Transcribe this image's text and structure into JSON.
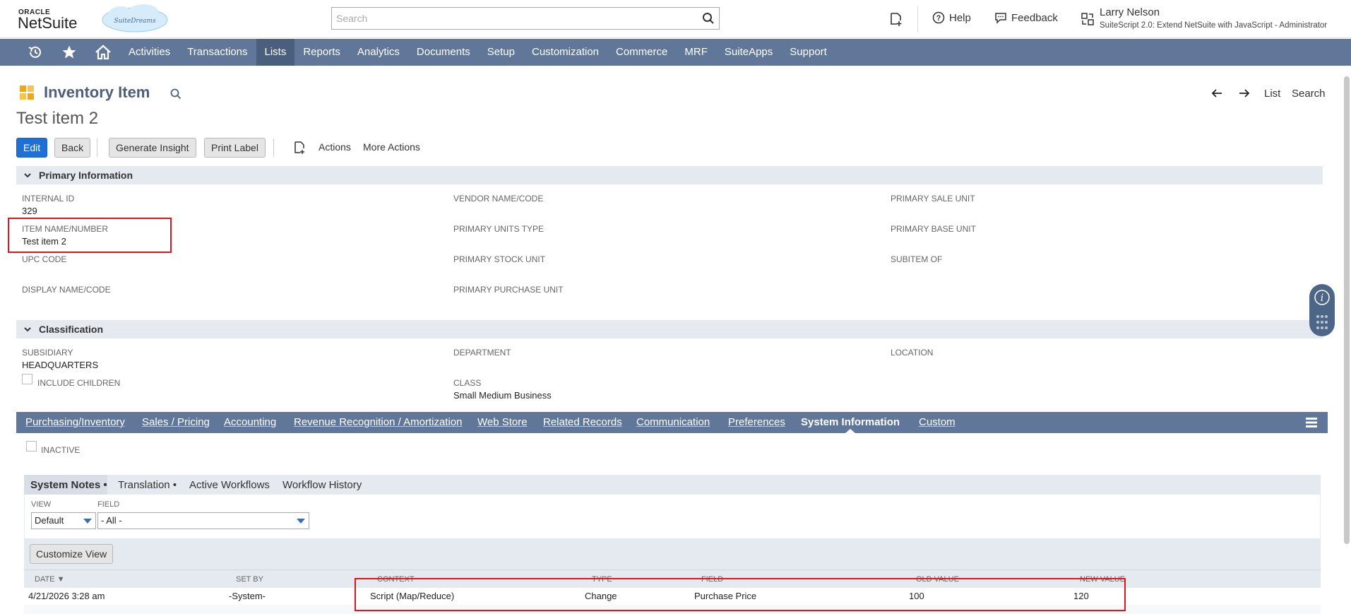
{
  "header": {
    "oracle_label": "ORACLE",
    "netsuite_label": "NetSuite",
    "cloud_label": "SuiteDreams",
    "search_placeholder": "Search",
    "help_label": "Help",
    "feedback_label": "Feedback",
    "user_name": "Larry Nelson",
    "user_role": "SuiteScript 2.0: Extend NetSuite with JavaScript - Administrator"
  },
  "nav": {
    "items": [
      "Activities",
      "Transactions",
      "Lists",
      "Reports",
      "Analytics",
      "Documents",
      "Setup",
      "Customization",
      "Commerce",
      "MRF",
      "SuiteApps",
      "Support"
    ],
    "active": "Lists"
  },
  "record": {
    "type": "Inventory Item",
    "title": "Test item 2",
    "pager": {
      "list": "List",
      "search": "Search"
    }
  },
  "actions": {
    "edit": "Edit",
    "back": "Back",
    "generate_insight": "Generate Insight",
    "print_label": "Print Label",
    "actions": "Actions",
    "more_actions": "More Actions"
  },
  "primary": {
    "section_title": "Primary Information",
    "internal_id_label": "INTERNAL ID",
    "internal_id_value": "329",
    "item_name_label": "ITEM NAME/NUMBER",
    "item_name_value": "Test item 2",
    "upc_label": "UPC CODE",
    "display_name_label": "DISPLAY NAME/CODE",
    "vendor_label": "VENDOR NAME/CODE",
    "units_type_label": "PRIMARY UNITS TYPE",
    "stock_unit_label": "PRIMARY STOCK UNIT",
    "purchase_unit_label": "PRIMARY PURCHASE UNIT",
    "sale_unit_label": "PRIMARY SALE UNIT",
    "base_unit_label": "PRIMARY BASE UNIT",
    "subitem_label": "SUBITEM OF"
  },
  "classification": {
    "section_title": "Classification",
    "subsidiary_label": "SUBSIDIARY",
    "subsidiary_value": "HEADQUARTERS",
    "include_children_label": "INCLUDE CHILDREN",
    "department_label": "DEPARTMENT",
    "class_label": "CLASS",
    "class_value": "Small Medium Business",
    "location_label": "LOCATION"
  },
  "subtabs": {
    "items": [
      "Purchasing/Inventory",
      "Sales / Pricing",
      "Accounting",
      "Revenue Recognition / Amortization",
      "Web Store",
      "Related Records",
      "Communication",
      "Preferences",
      "System Information",
      "Custom"
    ],
    "active": "System Information"
  },
  "system_info": {
    "inactive_label": "INACTIVE",
    "inner_tabs": [
      "System Notes •",
      "Translation •",
      "Active Workflows",
      "Workflow History"
    ],
    "active_inner_tab": "System Notes •",
    "view_label": "VIEW",
    "view_value": "Default",
    "field_label": "FIELD",
    "field_value": "- All -",
    "customize_view": "Customize View",
    "columns": [
      "DATE ▼",
      "SET BY",
      "CONTEXT",
      "TYPE",
      "FIELD",
      "OLD VALUE",
      "NEW VALUE"
    ],
    "rows": [
      {
        "date": "4/21/2026 3:28 am",
        "set_by": "-System-",
        "context": "Script (Map/Reduce)",
        "type": "Change",
        "field": "Purchase Price",
        "old_value": "100",
        "new_value": "120"
      }
    ]
  }
}
